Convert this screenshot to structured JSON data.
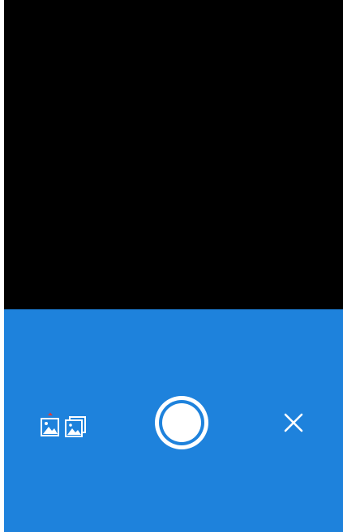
{
  "screen": {
    "viewfinder_color": "#000000",
    "control_bar_color": "#1e82dc",
    "accent_dot_color": "#e53935"
  },
  "controls": {
    "gallery_single_icon": "image-icon",
    "gallery_multi_icon": "images-stack-icon",
    "shutter_icon": "shutter-button",
    "close_icon": "close-icon"
  }
}
